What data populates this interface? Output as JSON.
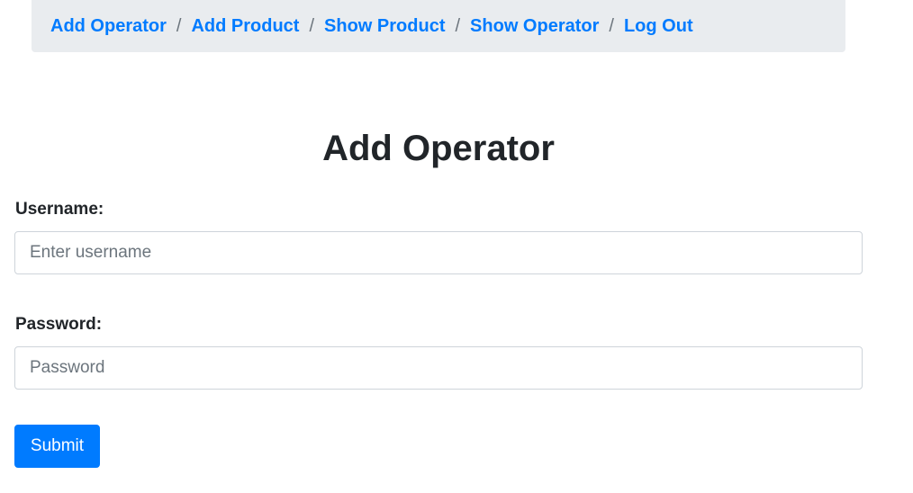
{
  "nav": {
    "items": [
      {
        "label": "Add Operator"
      },
      {
        "label": "Add Product"
      },
      {
        "label": "Show Product"
      },
      {
        "label": "Show Operator"
      },
      {
        "label": "Log Out"
      }
    ],
    "separator": "/"
  },
  "page": {
    "title": "Add Operator"
  },
  "form": {
    "username_label": "Username:",
    "username_placeholder": "Enter username",
    "username_value": "",
    "password_label": "Password:",
    "password_placeholder": "Password",
    "password_value": "",
    "submit_label": "Submit"
  },
  "colors": {
    "link": "#007bff",
    "breadcrumb_bg": "#e9ecef",
    "button_bg": "#007bff"
  }
}
